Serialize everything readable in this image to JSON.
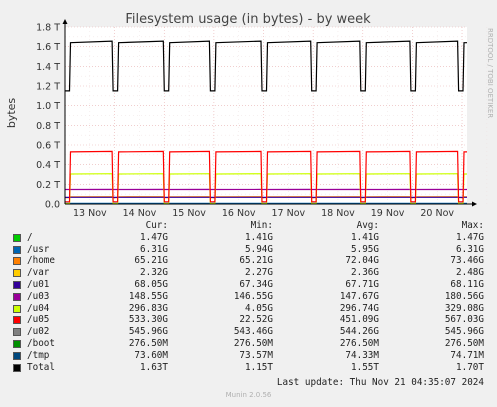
{
  "chart_data": {
    "type": "line",
    "title": "Filesystem usage (in bytes) - by week",
    "ylabel": "bytes",
    "side_label": "RRDTOOL / TOBI OETIKER",
    "ylim": [
      0,
      1800000000000.0
    ],
    "y_ticks": [
      {
        "value": 0,
        "label": "0.0"
      },
      {
        "value": 200000000000.0,
        "label": "0.2 T"
      },
      {
        "value": 400000000000.0,
        "label": "0.4 T"
      },
      {
        "value": 600000000000.0,
        "label": "0.6 T"
      },
      {
        "value": 800000000000.0,
        "label": "0.8 T"
      },
      {
        "value": 1000000000000.0,
        "label": "1.0 T"
      },
      {
        "value": 1200000000000.0,
        "label": "1.2 T"
      },
      {
        "value": 1400000000000.0,
        "label": "1.4 T"
      },
      {
        "value": 1600000000000.0,
        "label": "1.6 T"
      },
      {
        "value": 1800000000000.0,
        "label": "1.8 T"
      }
    ],
    "xlim": [
      0,
      8.1
    ],
    "x_ticks": [
      {
        "value": 0.5,
        "label": "13 Nov"
      },
      {
        "value": 1.5,
        "label": "14 Nov"
      },
      {
        "value": 2.5,
        "label": "15 Nov"
      },
      {
        "value": 3.5,
        "label": "16 Nov"
      },
      {
        "value": 4.5,
        "label": "17 Nov"
      },
      {
        "value": 5.5,
        "label": "18 Nov"
      },
      {
        "value": 6.5,
        "label": "19 Nov"
      },
      {
        "value": 7.5,
        "label": "20 Nov"
      }
    ],
    "grid": true,
    "series": [
      {
        "name": "/",
        "color": "#00cc00",
        "cur": "1.47G",
        "min": "1.41G",
        "avg": "1.41G",
        "max": "1.47G",
        "base": 1410000000.0,
        "dip": 1410000000.0,
        "draw": false
      },
      {
        "name": "/usr",
        "color": "#0066b3",
        "cur": "6.31G",
        "min": "5.94G",
        "avg": "5.95G",
        "max": "6.31G",
        "base": 5950000000.0,
        "dip": 5940000000.0,
        "draw": true
      },
      {
        "name": "/home",
        "color": "#ff8000",
        "cur": "65.21G",
        "min": "65.21G",
        "avg": "72.04G",
        "max": "73.46G",
        "base": 73000000000.0,
        "dip": 65200000000.0,
        "draw": true
      },
      {
        "name": "/var",
        "color": "#ffcc00",
        "cur": "2.32G",
        "min": "2.27G",
        "avg": "2.36G",
        "max": "2.48G",
        "base": 2360000000.0,
        "dip": 2270000000.0,
        "draw": false
      },
      {
        "name": "/u01",
        "color": "#330099",
        "cur": "68.05G",
        "min": "67.34G",
        "avg": "67.71G",
        "max": "68.11G",
        "base": 67700000000.0,
        "dip": 67300000000.0,
        "draw": true
      },
      {
        "name": "/u03",
        "color": "#990099",
        "cur": "148.55G",
        "min": "146.55G",
        "avg": "147.67G",
        "max": "180.56G",
        "base": 147000000000.0,
        "dip": 147000000000.0,
        "draw": true
      },
      {
        "name": "/u04",
        "color": "#ccff00",
        "cur": "296.83G",
        "min": "4.05G",
        "avg": "296.74G",
        "max": "329.08G",
        "base": 305000000000.0,
        "dip": 4050000000.0,
        "draw": true
      },
      {
        "name": "/u05",
        "color": "#ff0000",
        "cur": "533.30G",
        "min": "22.52G",
        "avg": "451.09G",
        "max": "567.03G",
        "base": 530000000000.0,
        "dip": 22520000000.0,
        "draw": true
      },
      {
        "name": "/u02",
        "color": "#808080",
        "cur": "545.96G",
        "min": "543.46G",
        "avg": "544.26G",
        "max": "545.96G",
        "base": 544000000000.0,
        "dip": 543000000000.0,
        "draw": false
      },
      {
        "name": "/boot",
        "color": "#008f00",
        "cur": "276.50M",
        "min": "276.50M",
        "avg": "276.50M",
        "max": "276.50M",
        "base": 276500000.0,
        "dip": 276500000.0,
        "draw": false
      },
      {
        "name": "/tmp",
        "color": "#00487d",
        "cur": "73.60M",
        "min": "73.57M",
        "avg": "74.33M",
        "max": "74.71M",
        "base": 74300000.0,
        "dip": 73600000.0,
        "draw": false
      },
      {
        "name": "Total",
        "color": "#000000",
        "cur": "1.63T",
        "min": "1.15T",
        "avg": "1.55T",
        "max": "1.70T",
        "base": 1640000000000.0,
        "dip": 1150000000000.0,
        "draw": true
      }
    ],
    "dip_positions": [
      0.0,
      0.97,
      2.0,
      2.93,
      3.97,
      4.97,
      5.96,
      6.97,
      7.93
    ]
  },
  "legend": {
    "headers": {
      "cur": "Cur:",
      "min": "Min:",
      "avg": "Avg:",
      "max": "Max:"
    }
  },
  "last_update": "Last update: Thu Nov 21 04:35:07 2024",
  "munin_version": "Munin 2.0.56"
}
